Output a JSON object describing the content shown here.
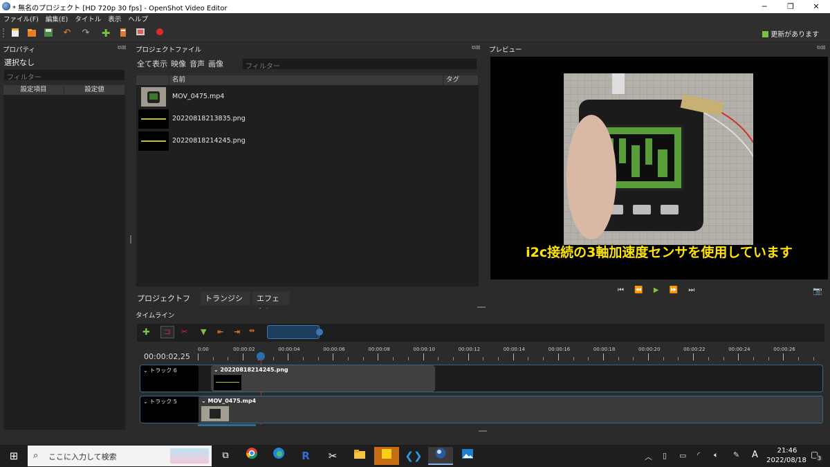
{
  "window": {
    "title": "* 無名のプロジェクト [HD 720p 30 fps] - OpenShot Video Editor"
  },
  "menu": [
    "ファイル(F)",
    "編集(E)",
    "タイトル",
    "表示",
    "ヘルプ"
  ],
  "toolbar": {
    "update_label": "更新があります"
  },
  "properties": {
    "title": "プロパティ",
    "selection": "選択なし",
    "filter_placeholder": "フィルター",
    "col_setting": "設定項目",
    "col_value": "設定値"
  },
  "project_files": {
    "title": "プロジェクトファイル",
    "tabs": [
      "全て表示",
      "映像",
      "音声",
      "画像"
    ],
    "filter_placeholder": "フィルター",
    "col_name": "名前",
    "col_tag": "タグ",
    "files": [
      {
        "name": "MOV_0475.mp4"
      },
      {
        "name": "20220818213835.png"
      },
      {
        "name": "20220818214245.png"
      }
    ]
  },
  "bottom_tabs": [
    "プロジェクトファイル",
    "トランジション",
    "エフェクト"
  ],
  "preview": {
    "title": "プレビュー",
    "subtitle": "i2c接続の3軸加速度センサを使用しています"
  },
  "timeline": {
    "title": "タイムライン",
    "current_time": "00:00:02,25",
    "ruler": [
      "0:00",
      "00:00:02",
      "00:00:04",
      "00:00:06",
      "00:00:08",
      "00:00:10",
      "00:00:12",
      "00:00:14",
      "00:00:16",
      "00:00:18",
      "00:00:20",
      "00:00:22",
      "00:00:24",
      "00:00:26"
    ],
    "tracks": [
      {
        "label": "トラック 6",
        "clip": "20220818214245.png"
      },
      {
        "label": "トラック 5",
        "clip": "MOV_0475.mp4"
      }
    ]
  },
  "taskbar": {
    "search_placeholder": "ここに入力して検索",
    "time": "21:46",
    "date": "2022/08/18",
    "ime": "A",
    "notifications": "3"
  },
  "colors": {
    "accent_green": "#7fc241",
    "playhead": "#d02020",
    "track_border": "#2e6c92"
  }
}
